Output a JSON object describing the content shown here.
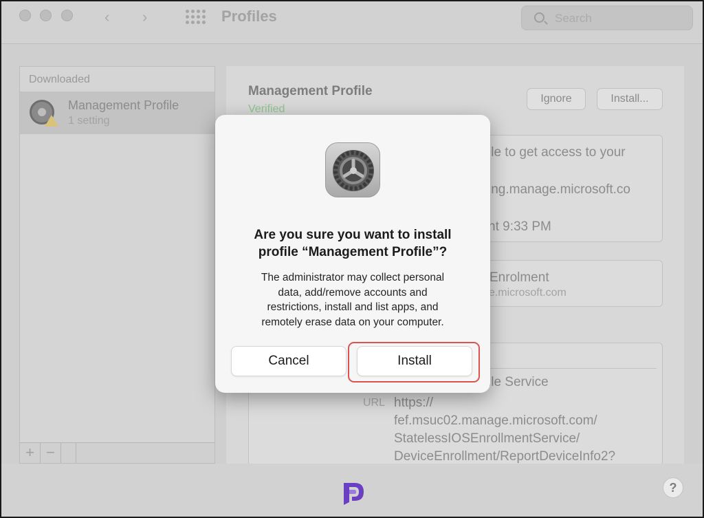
{
  "window": {
    "title": "Profiles",
    "search_placeholder": "Search"
  },
  "sidebar": {
    "section_label": "Downloaded",
    "items": [
      {
        "title": "Management Profile",
        "subtitle": "1 setting",
        "icon": "gear-icon",
        "badge_icon": "warning-icon"
      }
    ],
    "add_label": "+",
    "remove_label": "−"
  },
  "main": {
    "profile_title": "Management Profile",
    "status": "Verified",
    "ignore_label": "Ignore",
    "install_label": "Install...",
    "description_lines": [
      "ile to get access to your",
      "ing.manage.microsoft.co",
      "nt 9:33 PM"
    ],
    "enrolment_title": "Enrolment",
    "enrolment_sub": "ge.microsoft.com",
    "service_label": "ile Service",
    "url_label": "URL",
    "url_lines": [
      "https://",
      "fef.msuc02.manage.microsoft.com/",
      "StatelessIOSEnrollmentService/",
      "DeviceEnrollment/ReportDeviceInfo2?"
    ]
  },
  "dialog": {
    "icon": "system-preferences-gear-icon",
    "title_line1": "Are you sure you want to install",
    "title_line2": "profile “Management Profile”?",
    "message_lines": [
      "The administrator may collect personal",
      "data, add/remove accounts and",
      "restrictions, install and list apps, and",
      "remotely erase data on your computer."
    ],
    "cancel_label": "Cancel",
    "install_label": "Install"
  },
  "footer": {
    "help_label": "?"
  },
  "colors": {
    "highlight": "#d9534f",
    "verified": "#8fc48f",
    "logo_purple": "#6a3fc2"
  }
}
